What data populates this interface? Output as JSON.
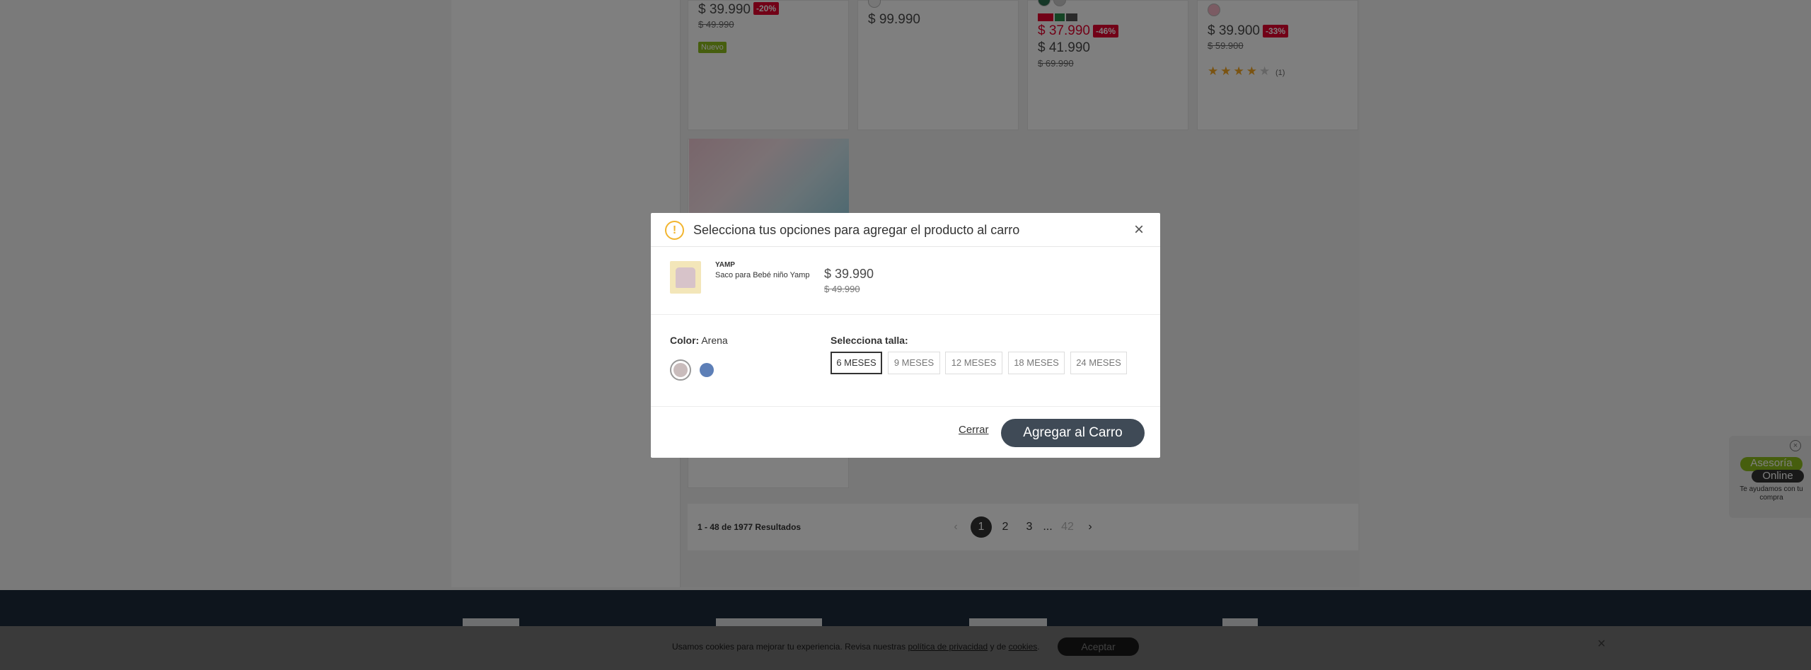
{
  "products": {
    "p1": {
      "price": "$ 39.990",
      "discount": "-20%",
      "old_price": "$ 49.990",
      "badge": "Nuevo"
    },
    "p2": {
      "price": "$ 99.990"
    },
    "p3": {
      "price": "$ 37.990",
      "discount": "-46%",
      "price2": "$ 41.990",
      "old_price": "$ 69.990"
    },
    "p4": {
      "price": "$ 39.900",
      "discount": "-33%",
      "old_price": "$ 59.900",
      "reviews": "(1)",
      "rating": 4
    }
  },
  "pagination": {
    "results": "1 - 48 de 1977 Resultados",
    "prev": "‹",
    "pages": [
      "1",
      "2",
      "3"
    ],
    "ellipsis": "...",
    "last": "42",
    "next": "›"
  },
  "modal": {
    "title": "Selecciona tus opciones para agregar el producto al carro",
    "close_icon": "×",
    "warning_icon": "!",
    "brand": "YAMP",
    "product_name": "Saco para Bebé niño Yamp",
    "price": "$ 39.990",
    "old_price": "$ 49.990",
    "color_label": "Color:",
    "color_value": "Arena",
    "colors": [
      "#c9bcbc",
      "#5d7fb7"
    ],
    "size_label": "Selecciona talla:",
    "sizes": [
      "6 MESES",
      "9 MESES",
      "12 MESES",
      "18 MESES",
      "24 MESES"
    ],
    "selected_size": "6 MESES",
    "cancel_label": "Cerrar",
    "add_label": "Agregar al Carro"
  },
  "chat": {
    "close": "×",
    "line1": "Asesoría",
    "line2": "Online",
    "subtitle": "Te ayudamos con tu compra"
  },
  "cookie": {
    "text_before": "Usamos cookies para mejorar tu experiencia. Revisa nuestras ",
    "privacy_link": "política de privacidad",
    "text_mid": " y de ",
    "cookies_link": "cookies",
    "text_after": ".",
    "accept": "Aceptar",
    "close": "×"
  },
  "colors": {
    "accent_dark": "#3f4a56",
    "discount_red": "#e4032e",
    "new_green": "#8cbd1d",
    "warning_yellow": "#f2b52f",
    "footer": "#1c2a3a"
  }
}
